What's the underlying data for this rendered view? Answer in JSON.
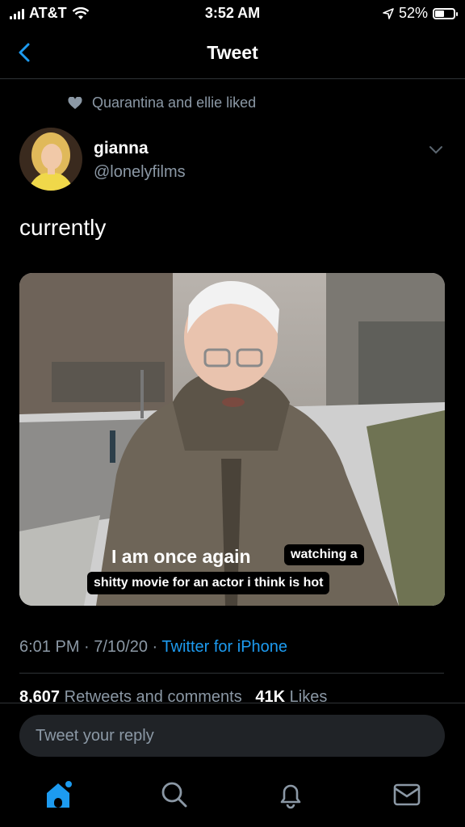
{
  "status_bar": {
    "carrier": "AT&T",
    "time": "3:52 AM",
    "battery": "52%",
    "battery_level": 0.52
  },
  "header": {
    "title": "Tweet",
    "back_icon": "chevron-left-icon"
  },
  "social_context": {
    "icon": "heart-icon",
    "text": "Quarantina and ellie liked"
  },
  "author": {
    "name": "gianna",
    "handle": "@lonelyfilms"
  },
  "tweet": {
    "text": "currently",
    "media_caption_line1": "I am once again",
    "media_caption_tag1": "watching a",
    "media_caption_line2": "shitty movie for an actor i think is hot",
    "timestamp": "6:01 PM · 7/10/20 · ",
    "source": "Twitter for iPhone"
  },
  "stats": {
    "retweets_count": "8,607",
    "retweets_label": "Retweets and comments",
    "likes_count": "41K",
    "likes_label": "Likes"
  },
  "reply": {
    "placeholder": "Tweet your reply"
  },
  "tabbar": {
    "items": [
      "home-icon",
      "search-icon",
      "bell-icon",
      "mail-icon"
    ]
  },
  "colors": {
    "accent": "#1d9bf0",
    "secondary_text": "#8b98a5",
    "background": "#000000"
  }
}
